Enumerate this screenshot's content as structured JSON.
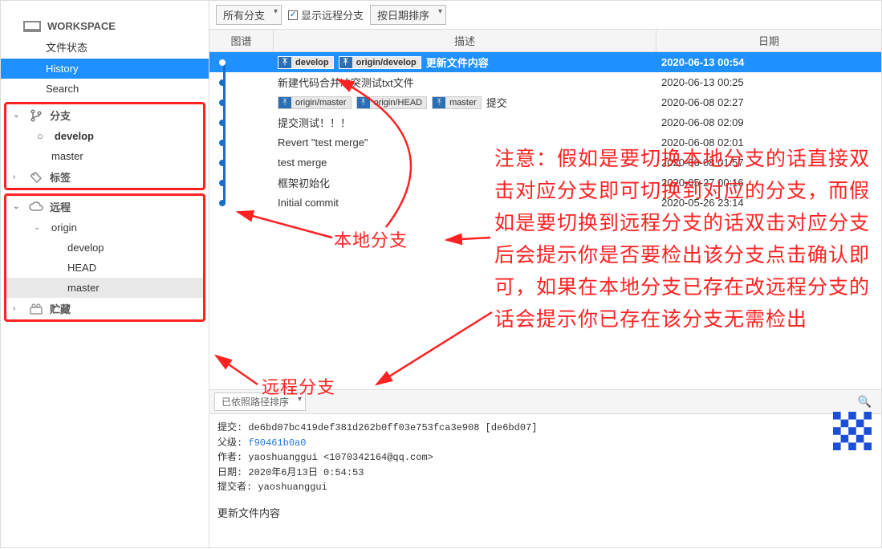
{
  "sidebar": {
    "workspace": {
      "title": "WORKSPACE",
      "items": [
        "文件状态",
        "History",
        "Search"
      ],
      "selected_index": 1
    },
    "branches": {
      "title": "分支",
      "items": [
        "develop",
        "master"
      ],
      "current_index": 0
    },
    "tags": {
      "title": "标签"
    },
    "remotes": {
      "title": "远程",
      "origin_label": "origin",
      "items": [
        "develop",
        "HEAD",
        "master"
      ],
      "selected_index": 2
    },
    "stash": {
      "title": "贮藏"
    }
  },
  "toolbar": {
    "all_branches": "所有分支",
    "show_remote": "显示远程分支",
    "sort_by_date": "按日期排序"
  },
  "columns": {
    "graph": "图谱",
    "desc": "描述",
    "date": "日期"
  },
  "commits": [
    {
      "tags": [
        {
          "label": "develop",
          "kind": "branch"
        },
        {
          "label": "origin/develop",
          "kind": "remote"
        }
      ],
      "msg": "更新文件内容",
      "date": "2020-06-13 00:54",
      "selected": true,
      "dot": "hollow"
    },
    {
      "tags": [],
      "msg": "新建代码合并冲突测试txt文件",
      "date": "2020-06-13 00:25",
      "dot": "fill"
    },
    {
      "tags": [
        {
          "label": "origin/master",
          "kind": "remote"
        },
        {
          "label": "origin/HEAD",
          "kind": "remote"
        },
        {
          "label": "master",
          "kind": "branch"
        }
      ],
      "msg": "提交",
      "date": "2020-06-08 02:27",
      "dot": "fill"
    },
    {
      "tags": [],
      "msg": "提交测试！！！",
      "date": "2020-06-08 02:09",
      "dot": "fill"
    },
    {
      "tags": [],
      "msg": "Revert \"test merge\"",
      "date": "2020-06-08 02:01",
      "dot": "fill"
    },
    {
      "tags": [],
      "msg": "test merge",
      "date": "2020-06-08 01:57",
      "dot": "fill"
    },
    {
      "tags": [],
      "msg": "框架初始化",
      "date": "2020-05-27 00:16",
      "dot": "fill"
    },
    {
      "tags": [],
      "msg": "Initial commit",
      "date": "2020-05-26 23:14",
      "dot": "fill",
      "end": true
    }
  ],
  "path_sort": "已依照路径排序",
  "detail": {
    "commit_label": "提交:",
    "commit": "de6bd07bc419def381d262b0ff03e753fca3e908 [de6bd07]",
    "parent_label": "父级:",
    "parent": "f90461b0a0",
    "author_label": "作者:",
    "author": "yaoshuanggui <1070342164@qq.com>",
    "date_label": "日期:",
    "date": "2020年6月13日 0:54:53",
    "committer_label": "提交者:",
    "committer": "yaoshuanggui",
    "message": "更新文件内容"
  },
  "annotations": {
    "local": "本地分支",
    "remote": "远程分支",
    "note": "注意：假如是要切换本地分支的话直接双击对应分支即可切换到对应的分支，而假如是要切换到远程分支的话双击对应分支后会提示你是否要检出该分支点击确认即可，如果在本地分支已存在改远程分支的话会提示你已存在该分支无需检出"
  }
}
